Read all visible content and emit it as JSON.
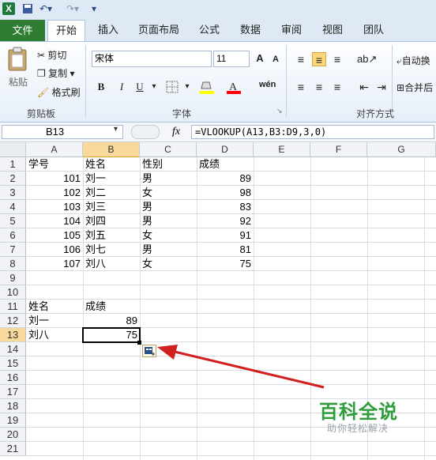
{
  "qat": {
    "icons": [
      "excel-icon",
      "save-icon",
      "undo-icon",
      "redo-icon",
      "customize-icon"
    ]
  },
  "tabs": [
    {
      "label": "文件"
    },
    {
      "label": "开始"
    },
    {
      "label": "插入"
    },
    {
      "label": "页面布局"
    },
    {
      "label": "公式"
    },
    {
      "label": "数据"
    },
    {
      "label": "审阅"
    },
    {
      "label": "视图"
    },
    {
      "label": "团队"
    }
  ],
  "ribbon": {
    "paste": "粘贴",
    "cut": "剪切",
    "copy": "复制",
    "format_painter": "格式刷",
    "clipboard_group": "剪贴板",
    "font_name": "宋体",
    "font_size": "11",
    "font_group": "字体",
    "bold": "B",
    "italic": "I",
    "underline": "U",
    "wen": "wén",
    "wrap": "自动换",
    "merge": "合并后",
    "align_group": "对齐方式",
    "colors": {
      "highlight": "#ffff00",
      "font": "#ff0000"
    }
  },
  "formula_bar": {
    "name_box": "B13",
    "fx": "fx",
    "formula": "=VLOOKUP(A13,B3:D9,3,0)"
  },
  "columns": [
    "A",
    "B",
    "C",
    "D",
    "E",
    "F",
    "G"
  ],
  "rows": [
    "1",
    "2",
    "3",
    "4",
    "5",
    "6",
    "7",
    "8",
    "9",
    "10",
    "11",
    "12",
    "13",
    "14",
    "15",
    "16",
    "17",
    "18",
    "19",
    "20",
    "21"
  ],
  "table": {
    "headers": [
      "学号",
      "姓名",
      "性别",
      "成绩"
    ],
    "rows": [
      {
        "id": "101",
        "name": "刘一",
        "sex": "男",
        "score": "89"
      },
      {
        "id": "102",
        "name": "刘二",
        "sex": "女",
        "score": "98"
      },
      {
        "id": "103",
        "name": "刘三",
        "sex": "男",
        "score": "83"
      },
      {
        "id": "104",
        "name": "刘四",
        "sex": "男",
        "score": "92"
      },
      {
        "id": "105",
        "name": "刘五",
        "sex": "女",
        "score": "91"
      },
      {
        "id": "106",
        "name": "刘七",
        "sex": "男",
        "score": "81"
      },
      {
        "id": "107",
        "name": "刘八",
        "sex": "女",
        "score": "75"
      }
    ]
  },
  "lookup": {
    "headers": [
      "姓名",
      "成绩"
    ],
    "rows": [
      {
        "name": "刘一",
        "score": "89"
      },
      {
        "name": "刘八",
        "score": "75"
      }
    ]
  },
  "watermark": {
    "title": "百科全说",
    "subtitle": "助你轻松解决"
  }
}
